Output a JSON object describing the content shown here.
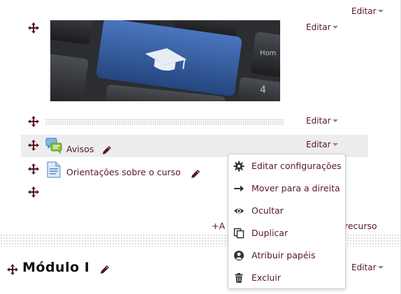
{
  "edit_label": "Editar",
  "items": [
    {
      "label": "Avisos"
    },
    {
      "label": "Orientações sobre o curso"
    }
  ],
  "menu": [
    {
      "label": "Editar configurações",
      "icon": "gear-icon"
    },
    {
      "label": "Mover para a direita",
      "icon": "arrow-right-icon"
    },
    {
      "label": "Ocultar",
      "icon": "eye-icon"
    },
    {
      "label": "Duplicar",
      "icon": "copy-icon"
    },
    {
      "label": "Atribuir papéis",
      "icon": "user-icon"
    },
    {
      "label": "Excluir",
      "icon": "trash-icon"
    }
  ],
  "add_resource": {
    "prefix": "+A",
    "suffix": "recurso"
  },
  "module": {
    "title": "Módulo I"
  },
  "colors": {
    "link": "#561626",
    "highlight": "#ededed",
    "key_blue": "#2f5aa0"
  }
}
